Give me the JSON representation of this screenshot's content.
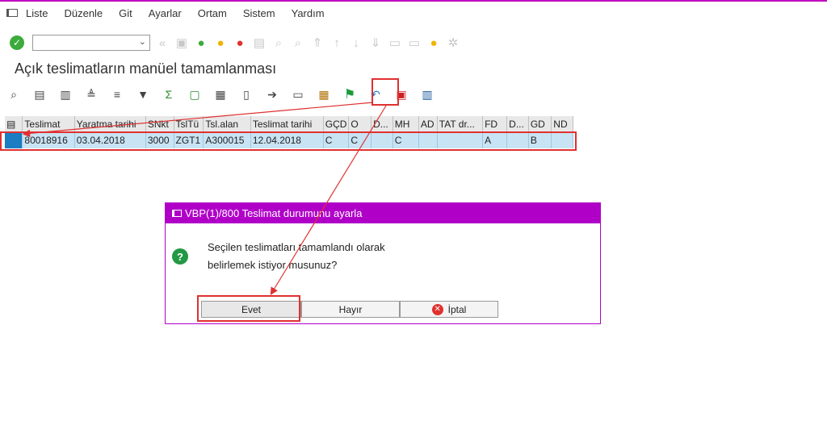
{
  "menu": [
    "Liste",
    "Düzenle",
    "Git",
    "Ayarlar",
    "Ortam",
    "Sistem",
    "Yardım"
  ],
  "page_title": "Açık teslimatların manüel tamamlanması",
  "table": {
    "columns": [
      "Teslimat",
      "Yaratma tarihi",
      "SNkt",
      "TslTü",
      "Tsl.alan",
      "Teslimat tarihi",
      "GÇD",
      "O",
      "D...",
      "MH",
      "AD",
      "TAT dr...",
      "FD",
      "D...",
      "GD",
      "ND"
    ],
    "rows": [
      [
        "80018916",
        "03.04.2018",
        "3000",
        "ZGT1",
        "A300015",
        "12.04.2018",
        "C",
        "C",
        "",
        "C",
        "",
        "",
        "A",
        "",
        "B",
        ""
      ]
    ]
  },
  "dialog": {
    "title": "VBP(1)/800 Teslimat durumunu ayarla",
    "message_line1": "Seçilen teslimatları tamamlandı olarak",
    "message_line2": "belirlemek istiyor musunuz?",
    "yes_label": "Evet",
    "no_label": "Hayır",
    "cancel_label": "İptal"
  },
  "colors": {
    "accent": "#b000c8",
    "highlight": "#e03030",
    "selection": "#c8e3f4"
  }
}
